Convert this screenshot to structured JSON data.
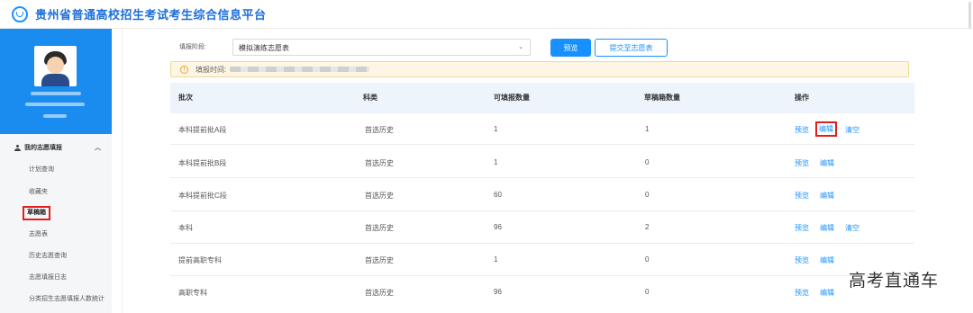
{
  "header": {
    "title": "贵州省普通高校招生考试考生综合信息平台",
    "logo_icon": "circle-logo-icon"
  },
  "sidebar": {
    "menu_group": "我的志愿填报",
    "items": [
      {
        "label": "计划查询",
        "active": false
      },
      {
        "label": "收藏夹",
        "active": false
      },
      {
        "label": "草稿箱",
        "active": true
      },
      {
        "label": "志愿表",
        "active": false
      },
      {
        "label": "历史志愿查询",
        "active": false
      },
      {
        "label": "志愿填报日志",
        "active": false
      },
      {
        "label": "分类招生志愿填报人数统计",
        "active": false
      }
    ]
  },
  "filter": {
    "label": "填报阶段:",
    "selected": "模拟演练志愿表",
    "preview_button": "预览",
    "submit_button": "提交至志愿表"
  },
  "notice": {
    "label": "填报时间:"
  },
  "table": {
    "columns": [
      "批次",
      "科类",
      "可填报数量",
      "草稿箱数量",
      "操作"
    ],
    "rows": [
      {
        "batch": "本科提前批A段",
        "category": "首选历史",
        "available": "1",
        "draft": "1",
        "ops": [
          "预览",
          "编辑",
          "清空"
        ]
      },
      {
        "batch": "本科提前批B段",
        "category": "首选历史",
        "available": "1",
        "draft": "0",
        "ops": [
          "预览",
          "编辑"
        ]
      },
      {
        "batch": "本科提前批C段",
        "category": "首选历史",
        "available": "60",
        "draft": "0",
        "ops": [
          "预览",
          "编辑"
        ]
      },
      {
        "batch": "本科",
        "category": "首选历史",
        "available": "96",
        "draft": "2",
        "ops": [
          "预览",
          "编辑",
          "清空"
        ]
      },
      {
        "batch": "提前高职专科",
        "category": "首选历史",
        "available": "1",
        "draft": "0",
        "ops": [
          "预览",
          "编辑"
        ]
      },
      {
        "batch": "高职专科",
        "category": "首选历史",
        "available": "96",
        "draft": "0",
        "ops": [
          "预览",
          "编辑"
        ]
      }
    ]
  },
  "watermark": "高考直通车",
  "colors": {
    "primary": "#1890ff",
    "sidebar_profile": "#1a8cf0",
    "highlight_box": "#e02020",
    "notice_bg": "#fdf6e4"
  }
}
